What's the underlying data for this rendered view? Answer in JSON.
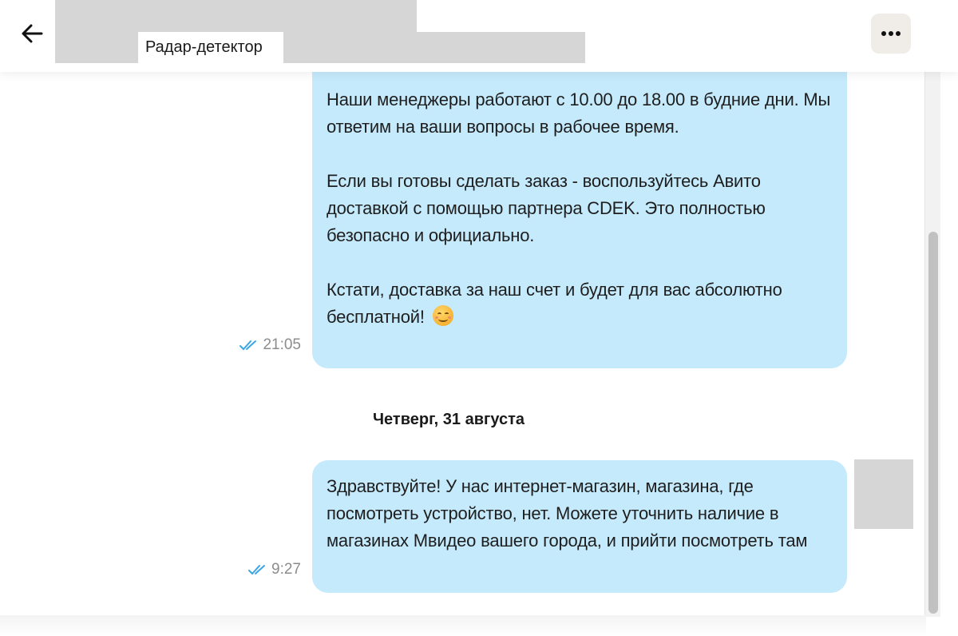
{
  "header": {
    "product_name": "Радар-детектор",
    "back_icon": "arrow-left-icon",
    "more_icon": "more-horizontal-icon"
  },
  "messages": [
    {
      "paragraphs": [
        "Наши менеджеры работают с 10.00 до 18.00 в будние дни. Мы ответим на ваши вопросы в рабочее время.",
        "Если вы готовы сделать заказ - воспользуйтесь Авито доставкой с помощью партнера CDEK. Это полностью безопасно и официально.",
        "Кстати, доставка за наш счет и будет для вас абсолютно бесплатной!"
      ],
      "emoji": "smiling-face-icon",
      "time": "21:05",
      "status_icon": "double-check-icon"
    },
    {
      "paragraphs": [
        "Здравствуйте! У нас интернет-магазин, магазина, где посмотреть устройство, нет. Можете уточнить наличие в магазинах Мвидео вашего города, и прийти посмотреть там"
      ],
      "time": "9:27",
      "status_icon": "double-check-icon"
    }
  ],
  "date_separator": "Четверг, 31 августа",
  "colors": {
    "bubble": "#c5eafc",
    "read_check": "#3aa6e6",
    "redaction": "#d6d6d6"
  }
}
